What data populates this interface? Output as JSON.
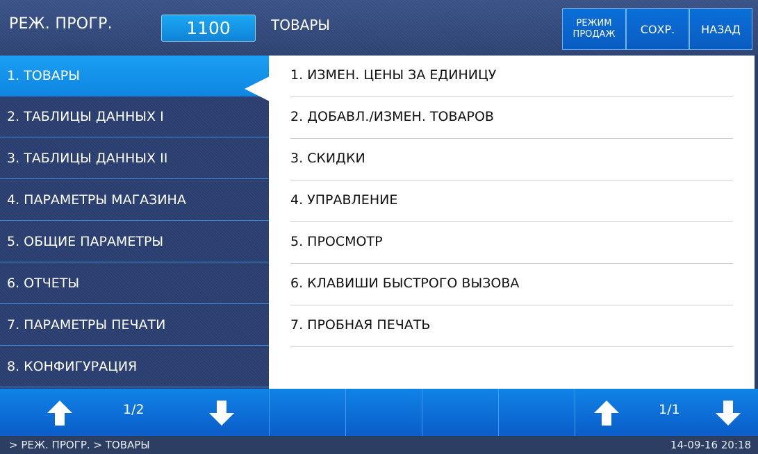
{
  "header": {
    "mode_title": "РЕЖ. ПРОГР.",
    "code": "1100",
    "section_title": "ТОВАРЫ",
    "buttons": {
      "sale_mode": "РЕЖИМ\nПРОДАЖ",
      "save": "СОХР.",
      "back": "НАЗАД"
    }
  },
  "sidebar": {
    "active_index": 0,
    "items": [
      {
        "label": "1. ТОВАРЫ"
      },
      {
        "label": "2. ТАБЛИЦЫ ДАННЫХ I"
      },
      {
        "label": "3. ТАБЛИЦЫ ДАННЫХ II"
      },
      {
        "label": "4. ПАРАМЕТРЫ МАГАЗИНА"
      },
      {
        "label": "5. ОБЩИЕ ПАРАМЕТРЫ"
      },
      {
        "label": "6. ОТЧЕТЫ"
      },
      {
        "label": "7. ПАРАМЕТРЫ ПЕЧАТИ"
      },
      {
        "label": "8. КОНФИГУРАЦИЯ"
      }
    ]
  },
  "content": {
    "items": [
      {
        "label": "1. ИЗМЕН. ЦЕНЫ ЗА ЕДИНИЦУ"
      },
      {
        "label": "2. ДОБАВЛ./ИЗМЕН. ТОВАРОВ"
      },
      {
        "label": "3. СКИДКИ"
      },
      {
        "label": "4. УПРАВЛЕНИЕ"
      },
      {
        "label": "5. ПРОСМОТР"
      },
      {
        "label": "6. КЛАВИШИ БЫСТРОГО ВЫЗОВА"
      },
      {
        "label": "7. ПРОБНАЯ ПЕЧАТЬ"
      }
    ]
  },
  "bottom": {
    "left_page": "1/2",
    "right_page": "1/1",
    "icons": {
      "up": "arrow-up-icon",
      "down": "arrow-down-icon"
    }
  },
  "status": {
    "breadcrumb": "> РЕЖ. ПРОГР.  > ТОВАРЫ",
    "datetime": "14-09-16  20:18"
  },
  "colors": {
    "accent": "#1a9ff3",
    "header_bg": "#34497a",
    "button_bg": "#0a66cf",
    "panel_bg": "#ffffff"
  }
}
